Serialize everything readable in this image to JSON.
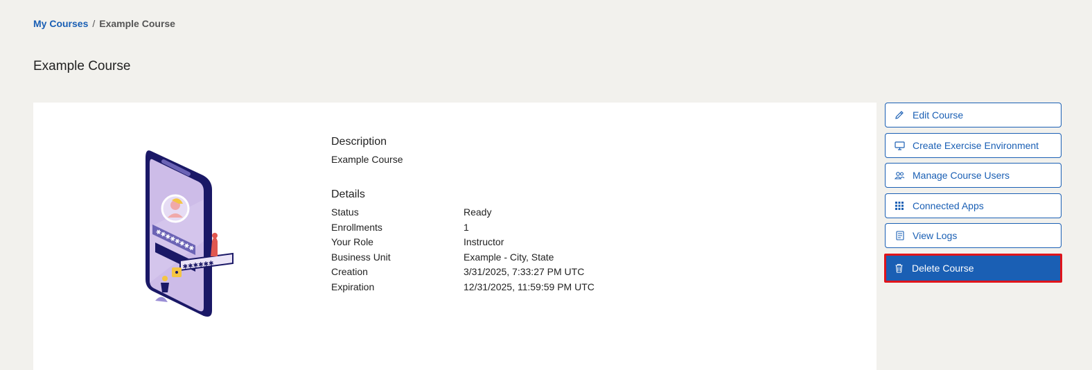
{
  "breadcrumb": {
    "parent": "My Courses",
    "separator": "/",
    "current": "Example Course"
  },
  "page_title": "Example Course",
  "description": {
    "heading": "Description",
    "text": "Example Course"
  },
  "details": {
    "heading": "Details",
    "rows": [
      {
        "key": "Status",
        "value": "Ready"
      },
      {
        "key": "Enrollments",
        "value": "1"
      },
      {
        "key": "Your Role",
        "value": "Instructor"
      },
      {
        "key": "Business Unit",
        "value": "Example - City, State"
      },
      {
        "key": "Creation",
        "value": "3/31/2025, 7:33:27 PM UTC"
      },
      {
        "key": "Expiration",
        "value": "12/31/2025, 11:59:59 PM UTC"
      }
    ]
  },
  "actions": [
    {
      "label": "Edit Course",
      "icon": "pencil-icon"
    },
    {
      "label": "Create Exercise Environment",
      "icon": "monitor-icon"
    },
    {
      "label": "Manage Course Users",
      "icon": "users-icon"
    },
    {
      "label": "Connected Apps",
      "icon": "grid-icon"
    },
    {
      "label": "View Logs",
      "icon": "logs-icon"
    },
    {
      "label": "Delete Course",
      "icon": "trash-icon"
    }
  ],
  "colors": {
    "accent": "#1a5fb4",
    "highlight": "#e0141b",
    "background": "#f2f1ed"
  }
}
